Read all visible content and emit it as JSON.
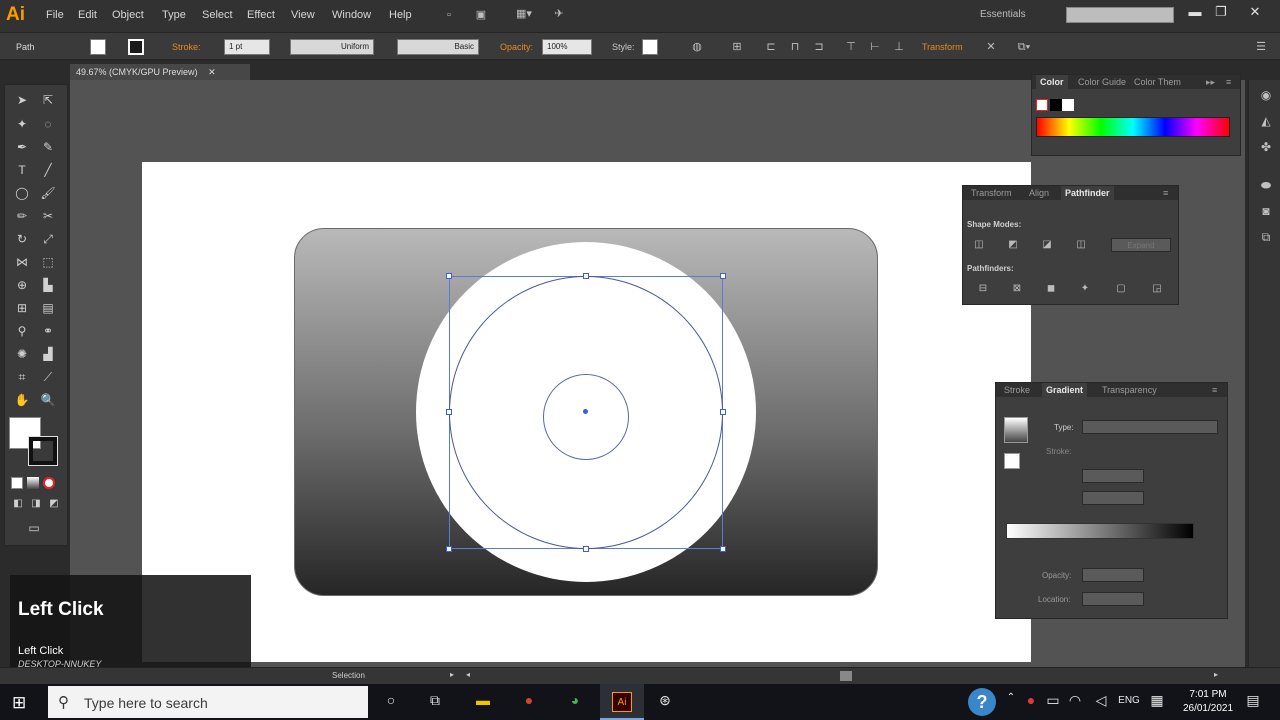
{
  "app": {
    "logo": "Ai",
    "workspace": "Essentials"
  },
  "menu": [
    "File",
    "Edit",
    "Object",
    "Type",
    "Select",
    "Effect",
    "View",
    "Window",
    "Help"
  ],
  "control_bar": {
    "object_type": "Path",
    "stroke_label": "Stroke:",
    "stroke_weight": "1 pt",
    "profile": "Uniform",
    "brush": "Basic",
    "opacity_label": "Opacity:",
    "opacity_value": "100%",
    "style_label": "Style:",
    "transform_label": "Transform"
  },
  "document": {
    "tab_title": "49.67% (CMYK/GPU Preview)"
  },
  "color_panel": {
    "tabs": [
      "Color",
      "Color Guide",
      "Color Them"
    ],
    "active": "Color"
  },
  "pathfinder_panel": {
    "tabs": [
      "Transform",
      "Align",
      "Pathfinder"
    ],
    "active": "Pathfinder",
    "shape_modes_label": "Shape Modes:",
    "expand_label": "Expand",
    "pathfinders_label": "Pathfinders:"
  },
  "gradient_panel": {
    "tabs": [
      "Stroke",
      "Gradient",
      "Transparency"
    ],
    "active": "Gradient",
    "type_label": "Type:",
    "stroke_label": "Stroke:",
    "opacity_label": "Opacity:",
    "location_label": "Location:"
  },
  "overlay": {
    "title": "Left Click",
    "subtitle": "Left Click",
    "subtitle2": "DESKTOP-NNUKEY"
  },
  "status": {
    "tool": "Selection"
  },
  "taskbar": {
    "search_placeholder": "Type here to search",
    "time": "7:01 PM",
    "date": "26/01/2021",
    "lang": "ENG"
  },
  "colors": {
    "accent": "#e58a22",
    "selection": "#3b5ce0",
    "taskbar": "#111318"
  }
}
